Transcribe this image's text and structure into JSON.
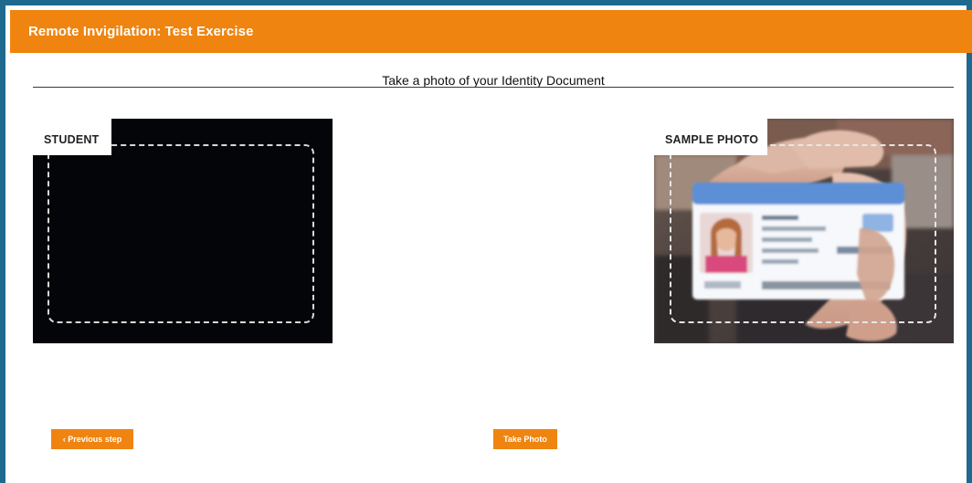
{
  "header": {
    "title": "Remote Invigilation: Test Exercise"
  },
  "instructions": {
    "heading": "Take a photo of your Identity Document"
  },
  "student_panel": {
    "label": "STUDENT"
  },
  "sample_panel": {
    "label": "SAMPLE PHOTO"
  },
  "actions": {
    "previous_label": "‹ Previous step",
    "take_photo_label": "Take Photo"
  },
  "colors": {
    "accent": "#ef8410",
    "frame_border": "#1d6a8e",
    "camera_bg": "#030508"
  }
}
